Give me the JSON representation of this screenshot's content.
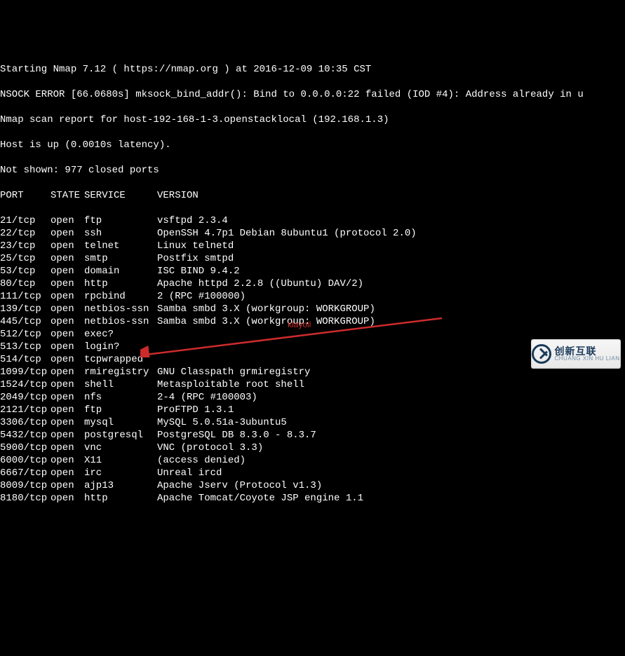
{
  "header": {
    "start_line": "Starting Nmap 7.12 ( https://nmap.org ) at 2016-12-09 10:35 CST",
    "nsock_error": "NSOCK ERROR [66.0680s] mksock_bind_addr(): Bind to 0.0.0.0:22 failed (IOD #4): Address already in u",
    "scan_report": "Nmap scan report for host-192-168-1-3.openstacklocal (192.168.1.3)",
    "host_up": "Host is up (0.0010s latency).",
    "not_shown": "Not shown: 977 closed ports"
  },
  "columns": {
    "port": "PORT",
    "state": "STATE",
    "service": "SERVICE",
    "version": "VERSION"
  },
  "rows": [
    {
      "port": "21/tcp",
      "state": "open",
      "service": "ftp",
      "version": "vsftpd 2.3.4"
    },
    {
      "port": "22/tcp",
      "state": "open",
      "service": "ssh",
      "version": "OpenSSH 4.7p1 Debian 8ubuntu1 (protocol 2.0)"
    },
    {
      "port": "23/tcp",
      "state": "open",
      "service": "telnet",
      "version": "Linux telnetd"
    },
    {
      "port": "25/tcp",
      "state": "open",
      "service": "smtp",
      "version": "Postfix smtpd"
    },
    {
      "port": "53/tcp",
      "state": "open",
      "service": "domain",
      "version": "ISC BIND 9.4.2"
    },
    {
      "port": "80/tcp",
      "state": "open",
      "service": "http",
      "version": "Apache httpd 2.2.8 ((Ubuntu) DAV/2)"
    },
    {
      "port": "111/tcp",
      "state": "open",
      "service": "rpcbind",
      "version": "2 (RPC #100000)"
    },
    {
      "port": "139/tcp",
      "state": "open",
      "service": "netbios-ssn",
      "version": "Samba smbd 3.X (workgroup: WORKGROUP)"
    },
    {
      "port": "445/tcp",
      "state": "open",
      "service": "netbios-ssn",
      "version": "Samba smbd 3.X (workgroup: WORKGROUP)"
    },
    {
      "port": "512/tcp",
      "state": "open",
      "service": "exec?",
      "version": ""
    },
    {
      "port": "513/tcp",
      "state": "open",
      "service": "login?",
      "version": ""
    },
    {
      "port": "514/tcp",
      "state": "open",
      "service": "tcpwrapped",
      "version": ""
    },
    {
      "port": "1099/tcp",
      "state": "open",
      "service": "rmiregistry",
      "version": "GNU Classpath grmiregistry"
    },
    {
      "port": "1524/tcp",
      "state": "open",
      "service": "shell",
      "version": "Metasploitable root shell"
    },
    {
      "port": "2049/tcp",
      "state": "open",
      "service": "nfs",
      "version": "2-4 (RPC #100003)"
    },
    {
      "port": "2121/tcp",
      "state": "open",
      "service": "ftp",
      "version": "ProFTPD 1.3.1"
    },
    {
      "port": "3306/tcp",
      "state": "open",
      "service": "mysql",
      "version": "MySQL 5.0.51a-3ubuntu5"
    },
    {
      "port": "5432/tcp",
      "state": "open",
      "service": "postgresql",
      "version": "PostgreSQL DB 8.3.0 - 8.3.7"
    },
    {
      "port": "5900/tcp",
      "state": "open",
      "service": "vnc",
      "version": "VNC (protocol 3.3)"
    },
    {
      "port": "6000/tcp",
      "state": "open",
      "service": "X11",
      "version": "(access denied)"
    },
    {
      "port": "6667/tcp",
      "state": "open",
      "service": "irc",
      "version": "Unreal ircd"
    },
    {
      "port": "8009/tcp",
      "state": "open",
      "service": "ajp13",
      "version": "Apache Jserv (Protocol v1.3)"
    },
    {
      "port": "8180/tcp",
      "state": "open",
      "service": "http",
      "version": "Apache Tomcat/Coyote JSP engine 1.1"
    }
  ],
  "annotation": {
    "text": "klayoil",
    "arrow_color": "#cc2b2b"
  },
  "watermark": {
    "cn": "创新互联",
    "en": "CHUANG XIN HU LIAN"
  }
}
